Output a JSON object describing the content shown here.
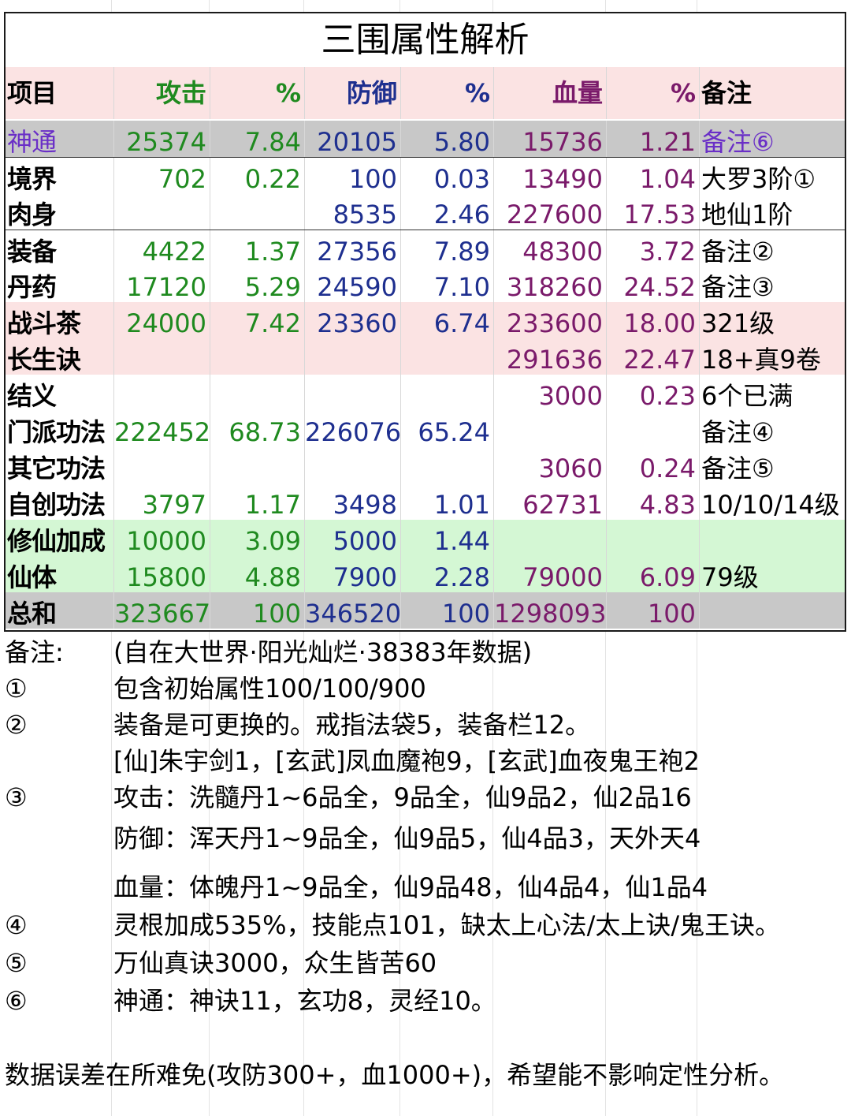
{
  "title": "三围属性解析",
  "header": [
    "项目",
    "攻击",
    "%",
    "防御",
    "%",
    "血量",
    "%",
    "备注"
  ],
  "rows": [
    {
      "name": "神通",
      "atk": "25374",
      "atk_p": "7.84",
      "def": "20105",
      "def_p": "5.80",
      "hp": "15736",
      "hp_p": "1.21",
      "note": "备注⑥"
    },
    {
      "name": "境界",
      "atk": "702",
      "atk_p": "0.22",
      "def": "100",
      "def_p": "0.03",
      "hp": "13490",
      "hp_p": "1.04",
      "note": "大罗3阶①"
    },
    {
      "name": "肉身",
      "atk": "",
      "atk_p": "",
      "def": "8535",
      "def_p": "2.46",
      "hp": "227600",
      "hp_p": "17.53",
      "note": "地仙1阶"
    },
    {
      "name": "装备",
      "atk": "4422",
      "atk_p": "1.37",
      "def": "27356",
      "def_p": "7.89",
      "hp": "48300",
      "hp_p": "3.72",
      "note": "备注②"
    },
    {
      "name": "丹药",
      "atk": "17120",
      "atk_p": "5.29",
      "def": "24590",
      "def_p": "7.10",
      "hp": "318260",
      "hp_p": "24.52",
      "note": "备注③"
    },
    {
      "name": "战斗茶",
      "atk": "24000",
      "atk_p": "7.42",
      "def": "23360",
      "def_p": "6.74",
      "hp": "233600",
      "hp_p": "18.00",
      "note": "321级"
    },
    {
      "name": "长生诀",
      "atk": "",
      "atk_p": "",
      "def": "",
      "def_p": "",
      "hp": "291636",
      "hp_p": "22.47",
      "note": "18+真9卷"
    },
    {
      "name": "结义",
      "atk": "",
      "atk_p": "",
      "def": "",
      "def_p": "",
      "hp": "3000",
      "hp_p": "0.23",
      "note": "6个已满"
    },
    {
      "name": "门派功法",
      "atk": "222452",
      "atk_p": "68.73",
      "def": "226076",
      "def_p": "65.24",
      "hp": "",
      "hp_p": "",
      "note": "备注④"
    },
    {
      "name": "其它功法",
      "atk": "",
      "atk_p": "",
      "def": "",
      "def_p": "",
      "hp": "3060",
      "hp_p": "0.24",
      "note": "备注⑤"
    },
    {
      "name": "自创功法",
      "atk": "3797",
      "atk_p": "1.17",
      "def": "3498",
      "def_p": "1.01",
      "hp": "62731",
      "hp_p": "4.83",
      "note": "10/10/14级"
    },
    {
      "name": "修仙加成",
      "atk": "10000",
      "atk_p": "3.09",
      "def": "5000",
      "def_p": "1.44",
      "hp": "",
      "hp_p": "",
      "note": ""
    },
    {
      "name": "仙体",
      "atk": "15800",
      "atk_p": "4.88",
      "def": "7900",
      "def_p": "2.28",
      "hp": "79000",
      "hp_p": "6.09",
      "note": "79级"
    },
    {
      "name": "总和",
      "atk": "323667",
      "atk_p": "100",
      "def": "346520",
      "def_p": "100",
      "hp": "1298093",
      "hp_p": "100",
      "note": ""
    }
  ],
  "notes": [
    {
      "k": "备注:",
      "v": "(自在大世界·阳光灿烂·38383年数据)"
    },
    {
      "k": "①",
      "v": "包含初始属性100/100/900"
    },
    {
      "k": "②",
      "v": "装备是可更换的。戒指法袋5，装备栏12。"
    },
    {
      "k": "",
      "v": "[仙]朱宇剑1，[玄武]凤血魔袍9，[玄武]血夜鬼王袍2"
    },
    {
      "k": "③",
      "v": "攻击：洗髓丹1~6品全，9品全，仙9品2，仙2品16"
    },
    {
      "k": "",
      "v": "防御：浑天丹1~9品全，仙9品5，仙4品3，天外天4"
    },
    {
      "k": "",
      "v": "血量：体魄丹1~9品全，仙9品48，仙4品4，仙1品4"
    },
    {
      "k": "④",
      "v": "灵根加成535%，技能点101，缺太上心法/太上诀/鬼王诀。"
    },
    {
      "k": "⑤",
      "v": "万仙真诀3000，众生皆苦60"
    },
    {
      "k": "⑥",
      "v": "神通：神诀11，玄功8，灵经10。"
    }
  ],
  "footer": "数据误差在所难免(攻防300+，血1000+)，希望能不影响定性分析。"
}
